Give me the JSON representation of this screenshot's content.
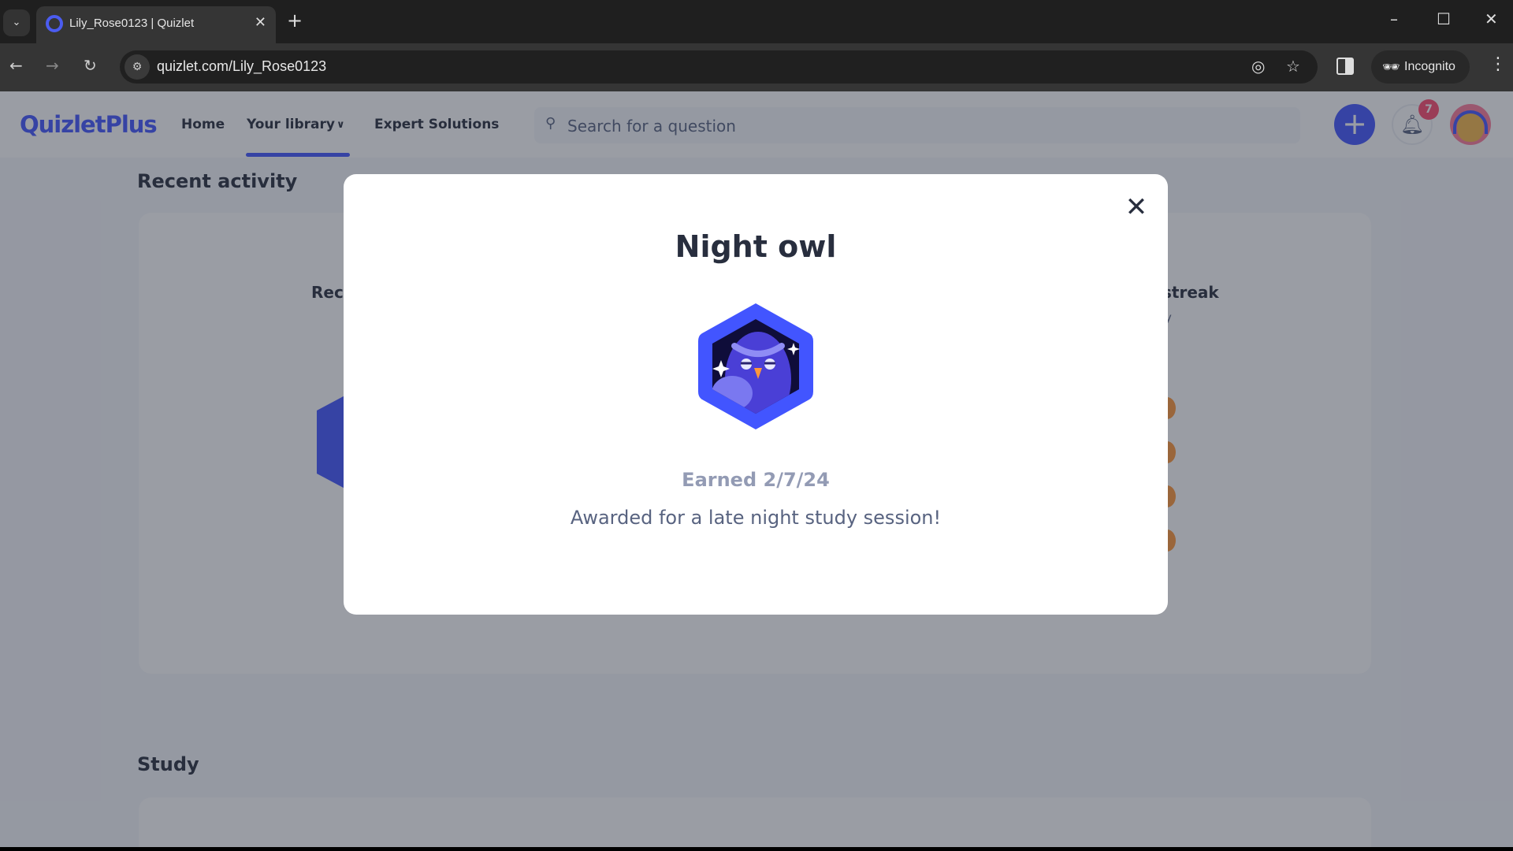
{
  "browser": {
    "tab_title": "Lily_Rose0123 | Quizlet",
    "url": "quizlet.com/Lily_Rose0123",
    "incognito_label": "Incognito"
  },
  "header": {
    "logo": "QuizletPlus",
    "nav": [
      {
        "label": "Home"
      },
      {
        "label": "Your library"
      },
      {
        "label": "Expert Solutions"
      }
    ],
    "search_placeholder": "Search for a question",
    "notification_count": "7"
  },
  "page": {
    "recent_activity": "Recent activity",
    "recent_card_title_partial": "Rec",
    "streak_partial": "streak",
    "streak_sub_partial": "y",
    "study": "Study"
  },
  "modal": {
    "title": "Night owl",
    "earned": "Earned 2/7/24",
    "description": "Awarded for a late night study session!",
    "badge_icon": "night-owl-badge"
  },
  "colors": {
    "brand": "#4255ff",
    "badge_dark": "#0f0d3a",
    "notification": "#ff4b6e"
  }
}
